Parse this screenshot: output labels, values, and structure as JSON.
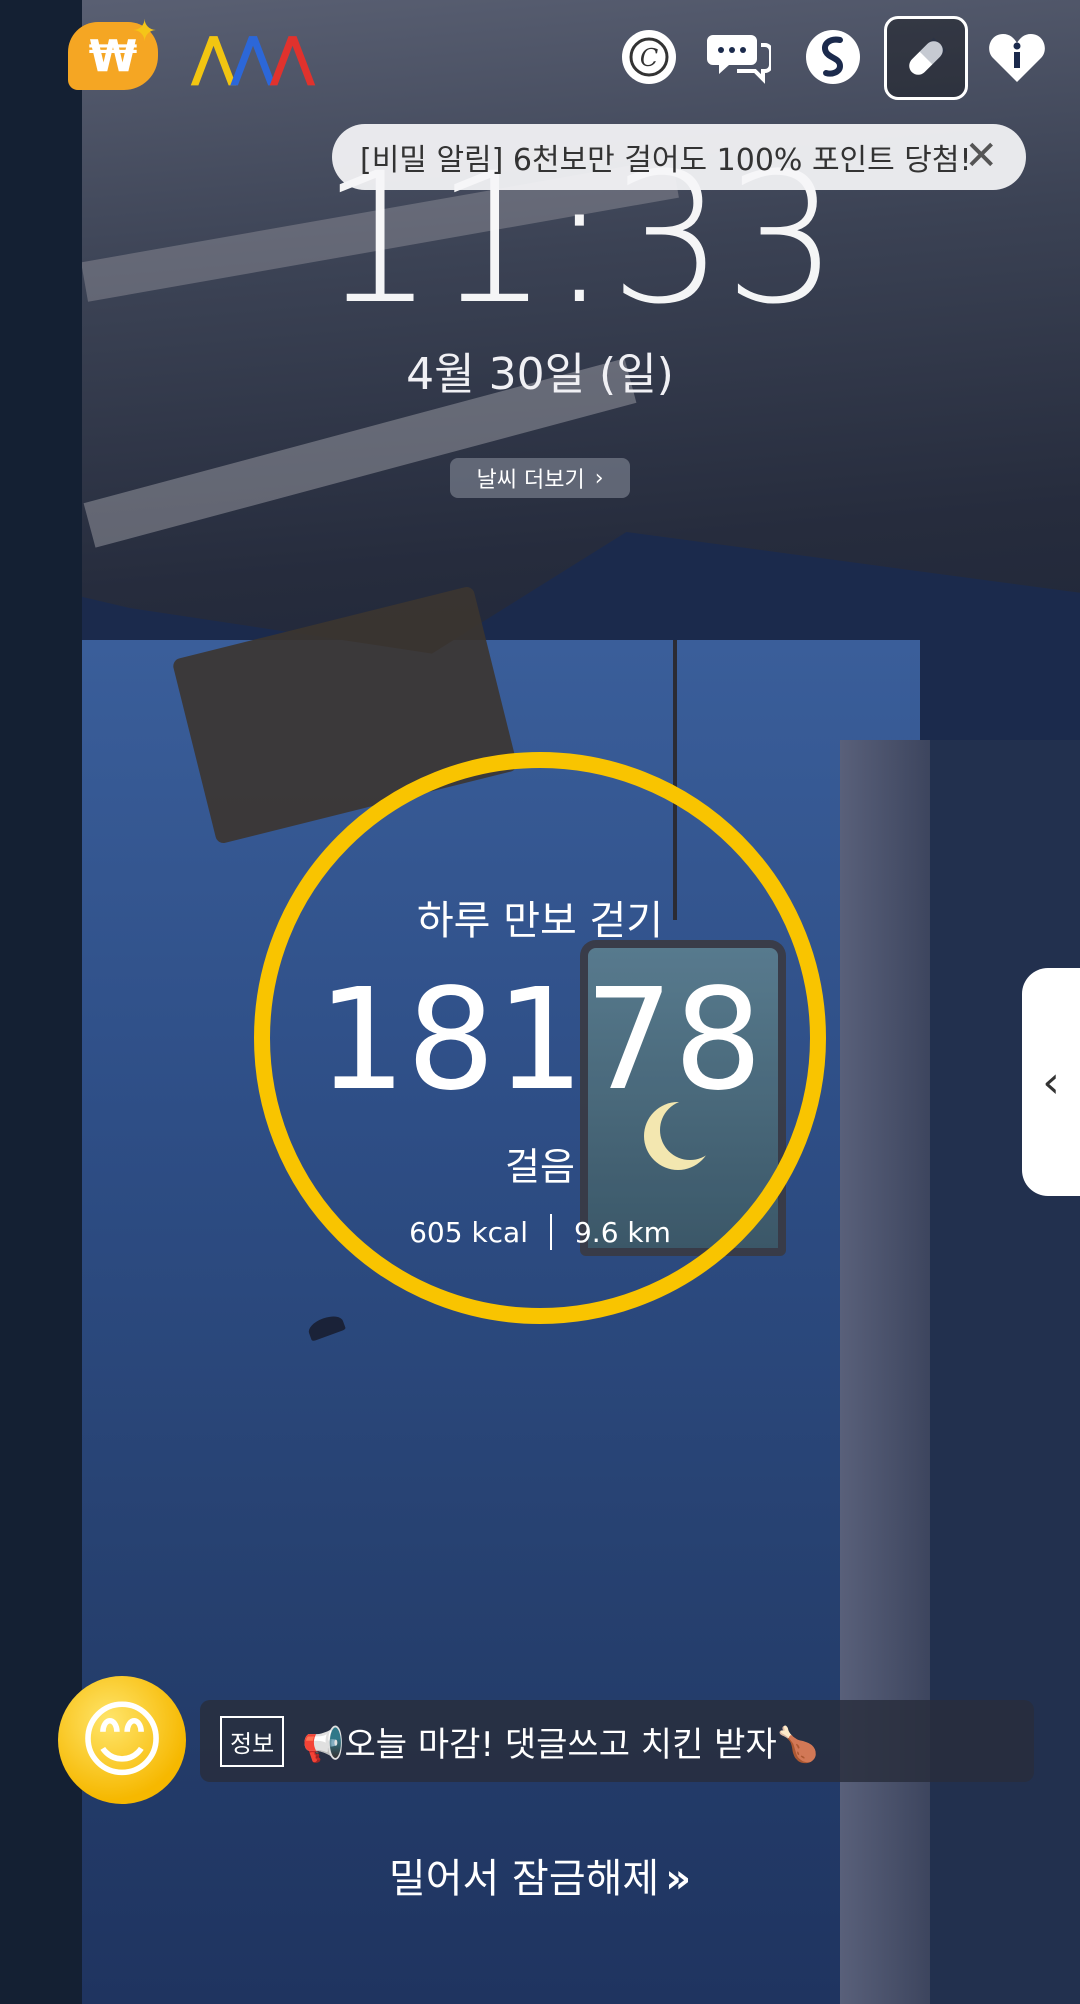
{
  "toast": {
    "text": "[비밀 알림] 6천보만 걸어도 100% 포인트 당첨!",
    "close_glyph": "✕"
  },
  "clock": {
    "time": "11:33",
    "date": "4월 30일 (일)"
  },
  "weather": {
    "label": "날씨 더보기",
    "chevron": "›"
  },
  "pedometer": {
    "title": "하루 만보 걷기",
    "steps": "18178",
    "unit": "걸음",
    "kcal": "605 kcal",
    "distance": "9.6 km",
    "ring_color": "#f9c400"
  },
  "topbar": {
    "icons": [
      "won-point-icon",
      "wave-logo-icon",
      "coin-icon",
      "chat-icon",
      "s-logo-icon",
      "pill-icon",
      "heart-info-icon"
    ],
    "won_glyph": "₩",
    "sparkle": "✦",
    "wave_glyphs": [
      "⋀",
      "⋀",
      "⋀"
    ]
  },
  "side_tab": {
    "chevron": "‹"
  },
  "ad": {
    "tag": "정보",
    "text": "📢오늘 마감! 댓글쓰고 치킨 받자🍗",
    "emoji": "😊"
  },
  "unlock": {
    "label": "밀어서 잠금해제",
    "arrows": "»"
  }
}
